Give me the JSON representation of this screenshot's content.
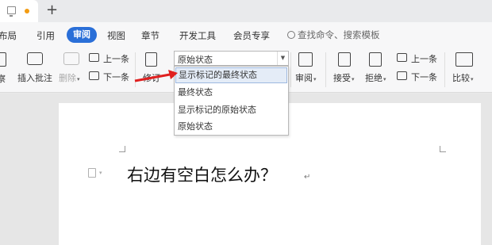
{
  "menu": {
    "items": [
      "布局",
      "引用",
      "审阅",
      "视图",
      "章节",
      "开发工具",
      "会员专享"
    ],
    "active": "审阅",
    "search": "查找命令、搜索模板"
  },
  "ribbon": {
    "insert_comment": "插入批注",
    "delete": "删除",
    "prev_comment": "上一条",
    "next_comment": "下一条",
    "revise": "修订",
    "review": "审阅",
    "accept": "接受",
    "reject": "拒绝",
    "prev_change": "上一条",
    "next_change": "下一条",
    "compare": "比较",
    "display_mode": "原始状态"
  },
  "dropdown": {
    "options": [
      "显示标记的最终状态",
      "最终状态",
      "显示标记的原始状态",
      "原始状态"
    ],
    "highlighted": "显示标记的最终状态"
  },
  "document": {
    "text": "右边有空白怎么办？"
  },
  "colors": {
    "accent": "#2a6fd8",
    "arrow": "#e02020",
    "highlight": "#e4ecf7"
  }
}
